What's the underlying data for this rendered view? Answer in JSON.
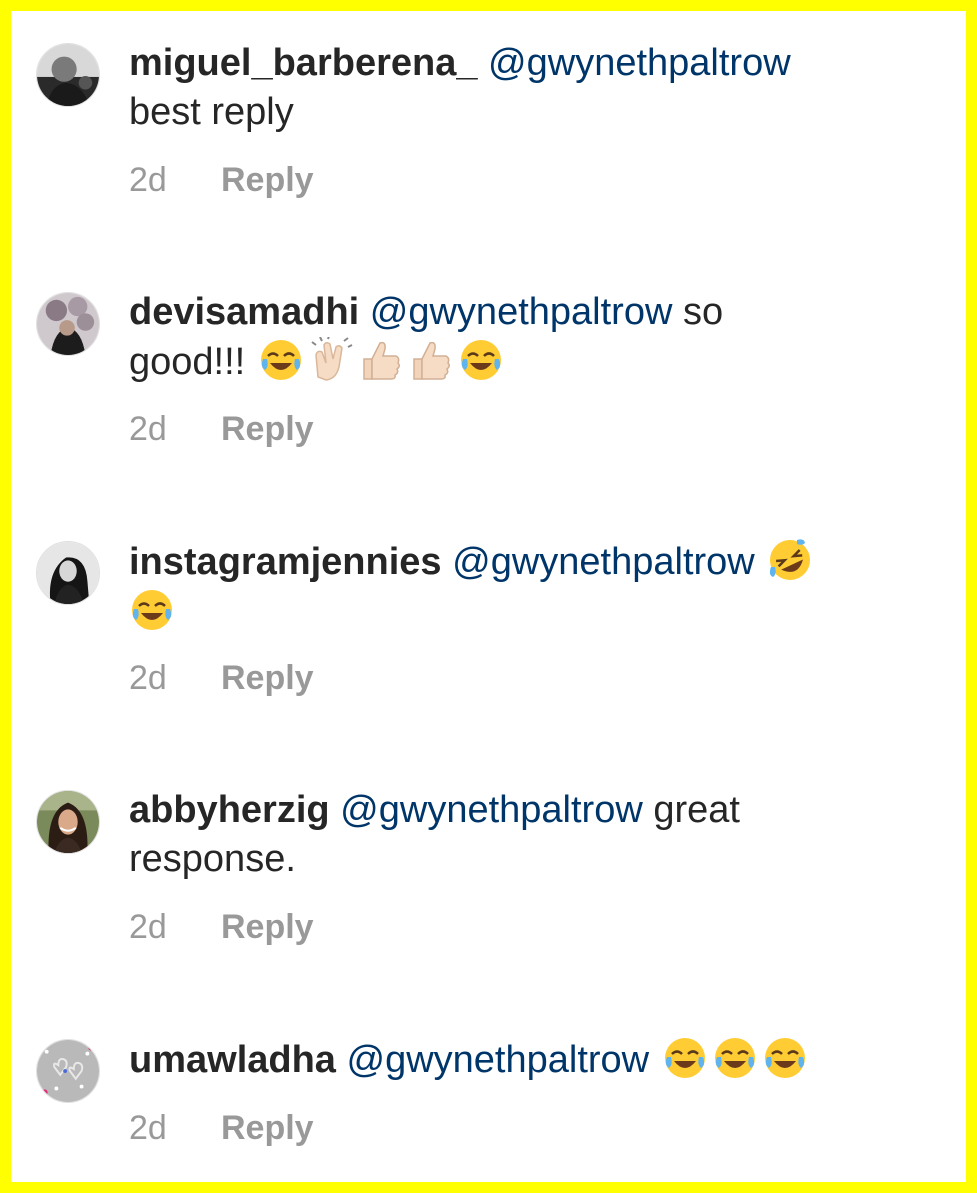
{
  "comments": [
    {
      "username": "miguel_barberena_",
      "mention": "@gwynethpaltrow",
      "text_lines": [
        "best reply"
      ],
      "text_after_mention": "",
      "emojis": [],
      "time": "2d",
      "reply_label": "Reply",
      "avatar": "avatar-man-dark"
    },
    {
      "username": "devisamadhi",
      "mention": "@gwynethpaltrow",
      "text_after_mention": "so",
      "text_line2": "good!!!",
      "emojis": [
        "tears-of-joy-emoji",
        "clapping-hands-emoji",
        "thumbs-up-emoji",
        "thumbs-up-emoji",
        "tears-of-joy-emoji"
      ],
      "time": "2d",
      "reply_label": "Reply",
      "avatar": "avatar-woman-balloons"
    },
    {
      "username": "instagramjennies",
      "mention": "@gwynethpaltrow",
      "emojis_line1": [
        "rolling-on-floor-laughing-emoji"
      ],
      "emojis_line2": [
        "tears-of-joy-emoji"
      ],
      "time": "2d",
      "reply_label": "Reply",
      "avatar": "avatar-woman-bw"
    },
    {
      "username": "abbyherzig",
      "mention": "@gwynethpaltrow",
      "text_after_mention": "great",
      "text_line2": "response.",
      "time": "2d",
      "reply_label": "Reply",
      "avatar": "avatar-woman-smiling"
    },
    {
      "username": "umawladha",
      "mention": "@gwynethpaltrow",
      "emojis": [
        "tears-of-joy-emoji",
        "tears-of-joy-emoji",
        "tears-of-joy-emoji"
      ],
      "time": "2d",
      "reply_label": "Reply",
      "avatar": "avatar-hearts-glitter"
    }
  ],
  "colors": {
    "border": "#ffff00",
    "username": "#262626",
    "mention": "#003569",
    "meta": "#999999"
  }
}
